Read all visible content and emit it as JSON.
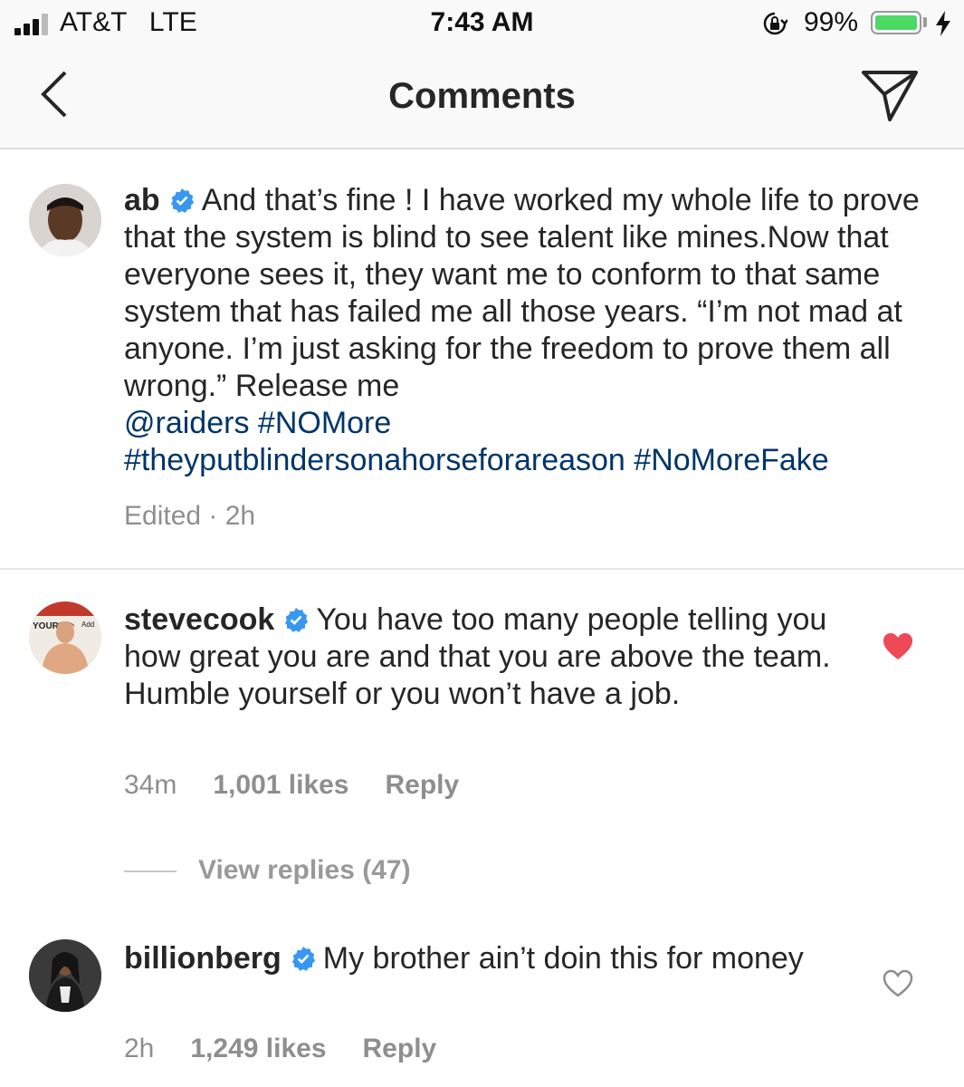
{
  "status_bar": {
    "carrier": "AT&T   LTE",
    "time": "7:43 AM",
    "battery_percent": "99%",
    "battery_level": 0.99,
    "icons": [
      "signal-icon",
      "orientation-lock-icon",
      "battery-icon",
      "charging-bolt-icon"
    ]
  },
  "nav": {
    "title": "Comments",
    "back_icon": "chevron-left-icon",
    "send_icon": "direct-send-icon"
  },
  "caption": {
    "username": "ab",
    "verified": true,
    "text": "And that’s fine ! I have worked my whole life to prove that the system is blind to see talent like mines.Now that everyone sees it, they want me to conform to that same system that has failed me all those years. “I’m not mad at anyone. I’m just asking for the freedom to prove them all wrong.” Release me",
    "mention": "@raiders",
    "tag1": "#NOMore",
    "tag2": "#theyputblindersonahorseforareason",
    "tag3": "#NoMoreFake",
    "meta": "Edited · 2h"
  },
  "comments": [
    {
      "username": "stevecook",
      "verified": true,
      "text": "You have too many people telling you how great you are and that you are above the team. Humble yourself or you won’t have a job.",
      "time": "34m",
      "likes": "1,001 likes",
      "reply_label": "Reply",
      "liked": true,
      "heart_color": "#ed4956"
    },
    {
      "username": "billionberg",
      "verified": true,
      "text": "My brother ain’t doin this for money",
      "time": "2h",
      "likes": "1,249 likes",
      "reply_label": "Reply",
      "liked": false,
      "heart_color": "#8e8e8e"
    }
  ],
  "view_replies": "View replies (47)",
  "colors": {
    "link": "#003569",
    "verified": "#3897f0",
    "meta": "#8e8e8e",
    "battery": "#4cd964"
  }
}
